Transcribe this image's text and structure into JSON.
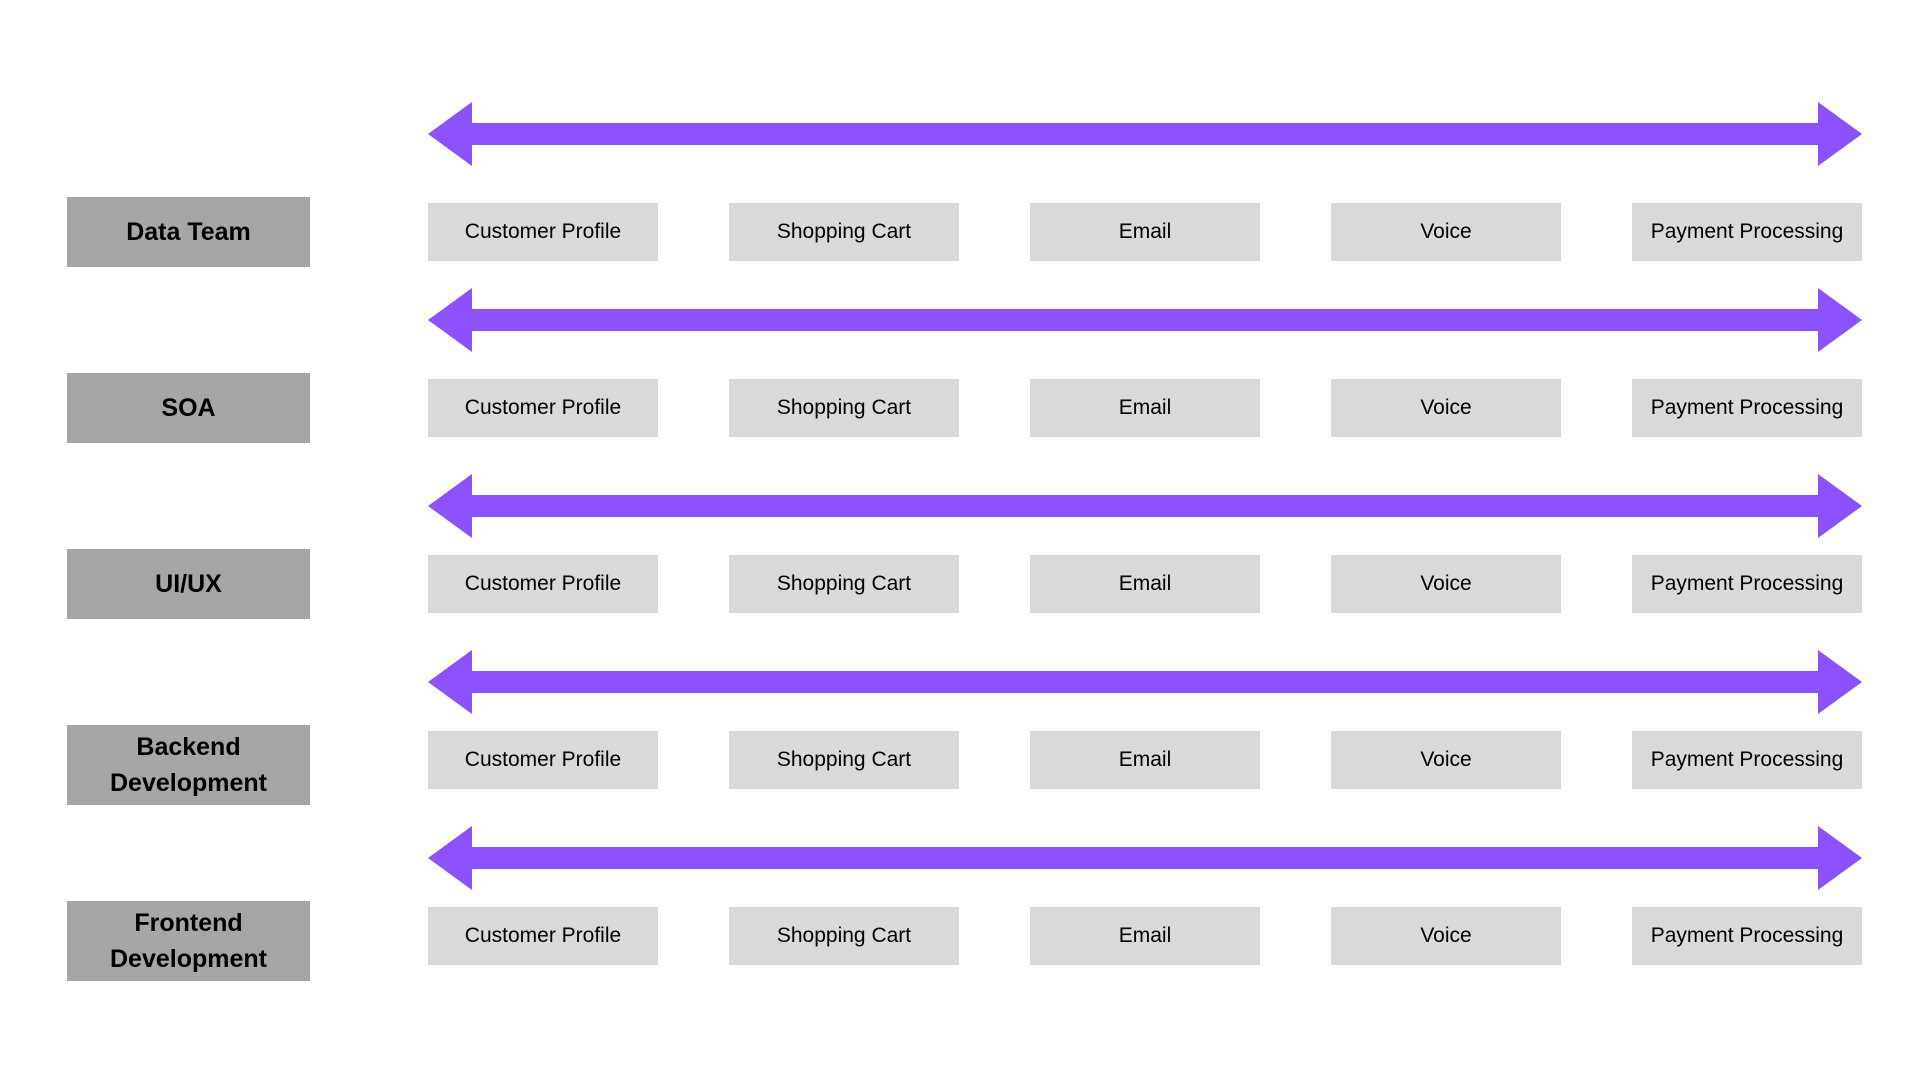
{
  "colors": {
    "arrow": "#8c52ff",
    "team_box": "#a6a6a6",
    "service_box": "#d9d9d9",
    "background": "#ffffff"
  },
  "rows": [
    {
      "team": "Data Team",
      "services": [
        "Customer Profile",
        "Shopping Cart",
        "Email",
        "Voice",
        "Payment Processing"
      ]
    },
    {
      "team": "SOA",
      "services": [
        "Customer Profile",
        "Shopping Cart",
        "Email",
        "Voice",
        "Payment Processing"
      ]
    },
    {
      "team": "UI/UX",
      "services": [
        "Customer Profile",
        "Shopping Cart",
        "Email",
        "Voice",
        "Payment Processing"
      ]
    },
    {
      "team": "Backend Development",
      "services": [
        "Customer Profile",
        "Shopping Cart",
        "Email",
        "Voice",
        "Payment Processing"
      ]
    },
    {
      "team": "Frontend Development",
      "services": [
        "Customer Profile",
        "Shopping Cart",
        "Email",
        "Voice",
        "Payment Processing"
      ]
    }
  ]
}
